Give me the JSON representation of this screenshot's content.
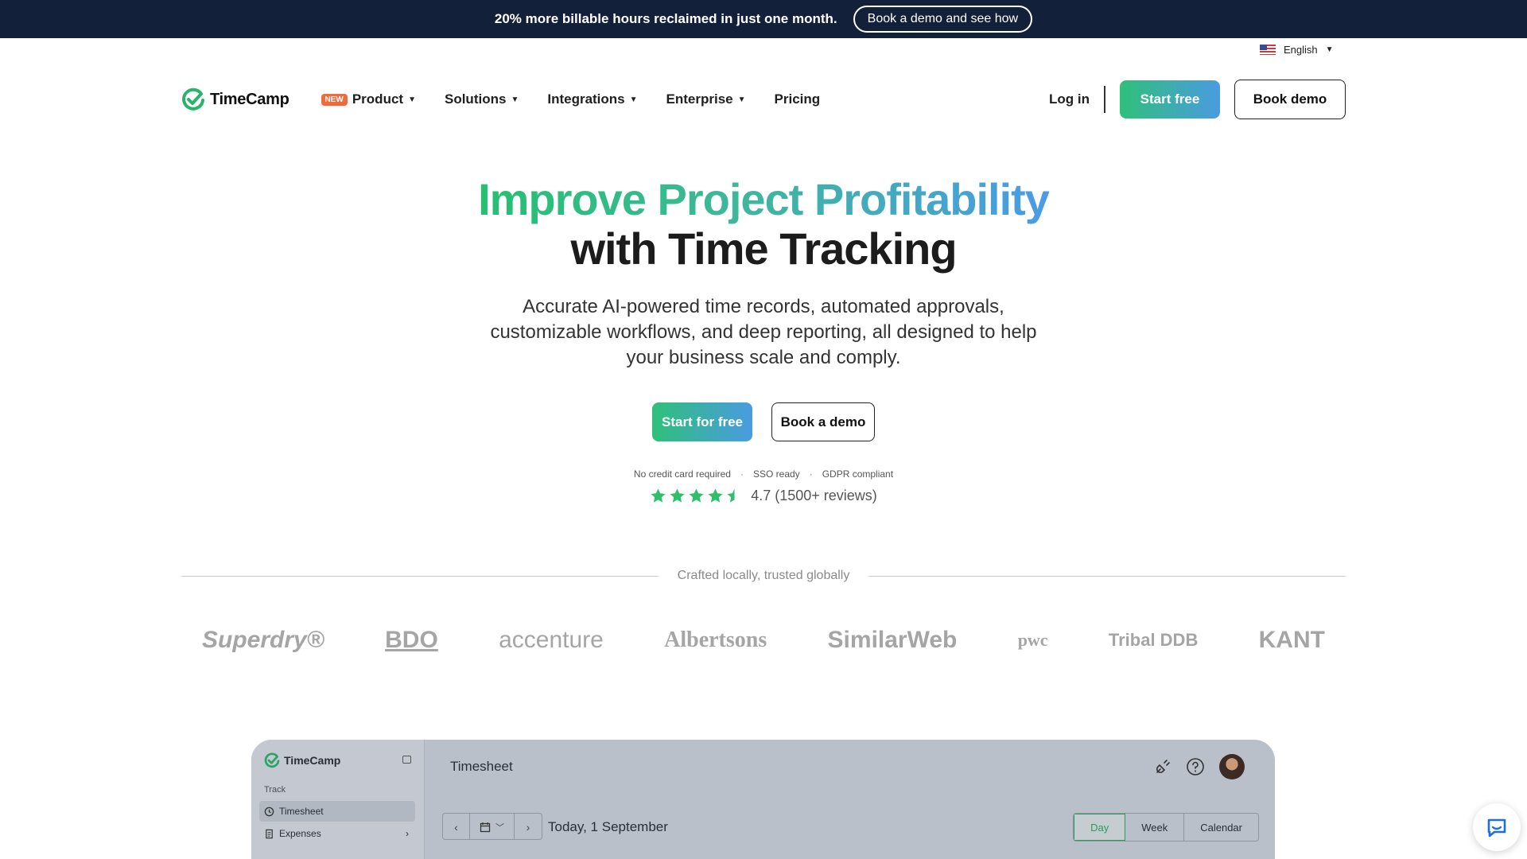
{
  "announcement": {
    "text": "20% more billable hours reclaimed in just one month.",
    "button": "Book a demo and see how"
  },
  "language": {
    "label": "English"
  },
  "nav": {
    "logo_text": "TimeCamp",
    "new_badge": "NEW",
    "items": [
      "Product",
      "Solutions",
      "Integrations",
      "Enterprise",
      "Pricing"
    ],
    "login": "Log in",
    "start": "Start free",
    "demo": "Book demo"
  },
  "hero": {
    "title_line1": "Improve Project Profitability",
    "title_line2": "with Time Tracking",
    "subtitle": "Accurate AI-powered time records, automated approvals, customizable workflows, and deep reporting, all designed to help your business scale and comply.",
    "cta_start": "Start for free",
    "cta_demo": "Book a demo",
    "trust": [
      "No credit card required",
      "SSO ready",
      "GDPR compliant"
    ],
    "rating_value": 4.5,
    "rating_text": "4.7 (1500+ reviews)"
  },
  "trusted": {
    "label": "Crafted locally, trusted globally",
    "logos": [
      "Superdry®",
      "BDO",
      "accenture",
      "Albertsons",
      "SimilarWeb",
      "pwc",
      "Tribal DDB",
      "KANT"
    ]
  },
  "app": {
    "logo_text": "TimeCamp",
    "section": "Track",
    "sidebar": [
      "Timesheet",
      "Expenses"
    ],
    "title": "Timesheet",
    "date": "Today, 1 September",
    "views": [
      "Day",
      "Week",
      "Calendar"
    ]
  },
  "colors": {
    "topbar": "#13203a",
    "brand_green": "#2fc07a",
    "brand_blue": "#4a9be0"
  }
}
